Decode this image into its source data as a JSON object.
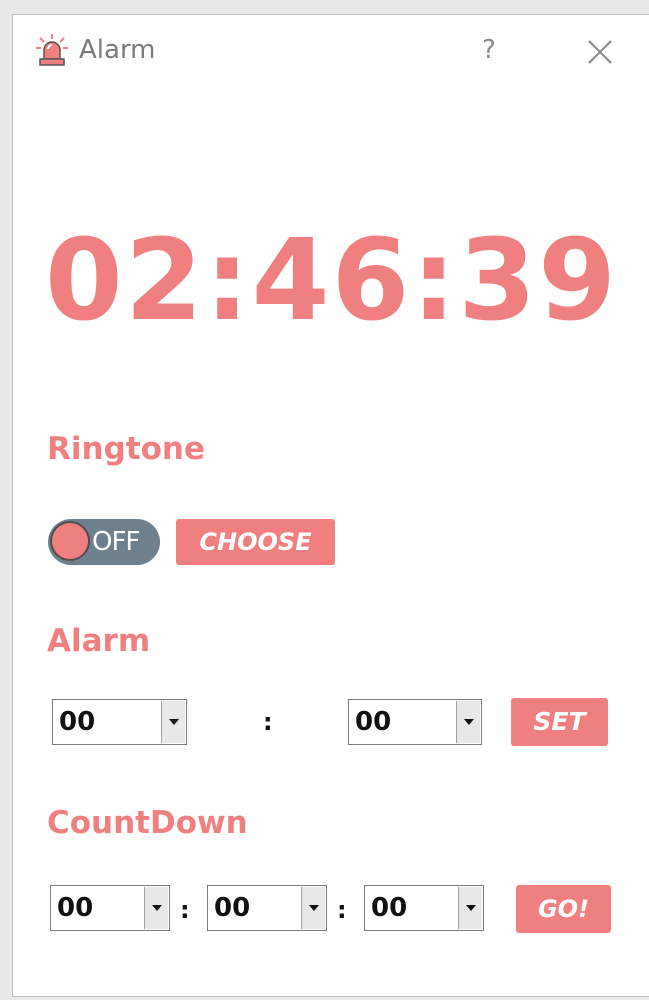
{
  "window": {
    "title": "Alarm",
    "help_label": "?",
    "icon": "alarm-siren-icon",
    "close_icon": "close-icon"
  },
  "clock": {
    "time": "02:46:39"
  },
  "ringtone": {
    "label": "Ringtone",
    "toggle_state": "OFF",
    "choose_label": "CHOOSE"
  },
  "alarm": {
    "label": "Alarm",
    "hour": "00",
    "separator": ":",
    "minute": "00",
    "set_label": "SET"
  },
  "countdown": {
    "label": "CountDown",
    "hours": "00",
    "separator1": ":",
    "minutes": "00",
    "separator2": ":",
    "seconds": "00",
    "go_label": "GO!"
  },
  "colors": {
    "accent": "#f08080",
    "toggle_track": "#6e7f8e"
  }
}
